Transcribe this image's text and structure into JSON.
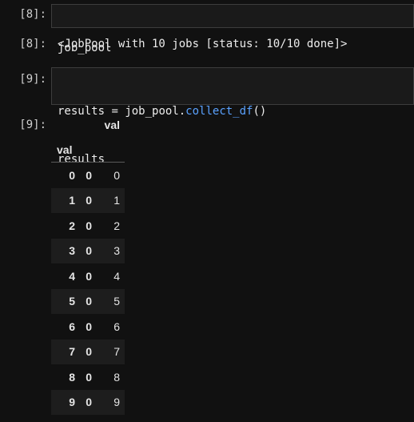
{
  "cells": [
    {
      "prompt": "[8]:",
      "code_lines": [
        "job_pool"
      ],
      "output_prompt": "[8]:",
      "output_text": "<JobPool with 10 jobs [status: 10/10 done]>"
    },
    {
      "prompt": "[9]:",
      "code": {
        "line1_var": "results",
        "line1_op": " = ",
        "line1_obj": "job_pool.",
        "line1_fn": "collect_df",
        "line1_paren": "()",
        "line2": "results"
      },
      "output_prompt": "[9]:"
    }
  ],
  "dataframe": {
    "column_header": "val",
    "index_name": "val",
    "rows": [
      {
        "i0": "0",
        "i1": "0",
        "val": "0"
      },
      {
        "i0": "1",
        "i1": "0",
        "val": "1"
      },
      {
        "i0": "2",
        "i1": "0",
        "val": "2"
      },
      {
        "i0": "3",
        "i1": "0",
        "val": "3"
      },
      {
        "i0": "4",
        "i1": "0",
        "val": "4"
      },
      {
        "i0": "5",
        "i1": "0",
        "val": "5"
      },
      {
        "i0": "6",
        "i1": "0",
        "val": "6"
      },
      {
        "i0": "7",
        "i1": "0",
        "val": "7"
      },
      {
        "i0": "8",
        "i1": "0",
        "val": "8"
      },
      {
        "i0": "9",
        "i1": "0",
        "val": "9"
      }
    ]
  },
  "colors": {
    "background": "#111111",
    "function_blue": "#5aa2ff",
    "row_stripe": "#1d1d1d"
  }
}
